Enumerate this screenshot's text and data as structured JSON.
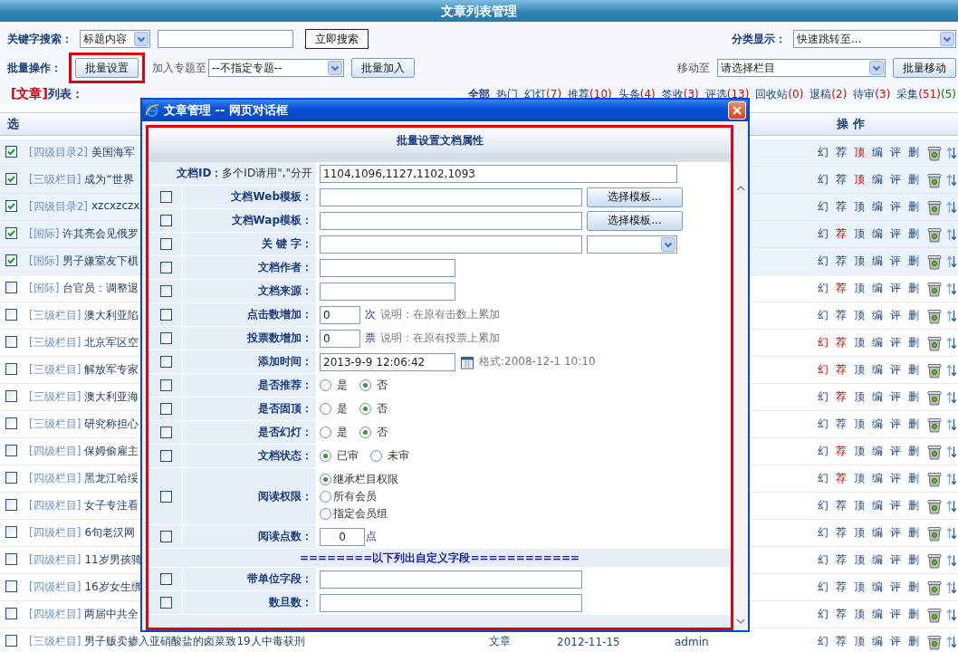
{
  "page_title": "文章列表管理",
  "search": {
    "label": "关键字搜索：",
    "scope": "标题内容",
    "button": "立即搜索"
  },
  "category": {
    "label": "分类显示：",
    "select": "快速跳转至..."
  },
  "batch": {
    "label": "批量操作：",
    "settings_button": "批量设置",
    "settings_highlighted": true,
    "topic_label": "加入专题至",
    "topic_select": "--不指定专题--",
    "add_button": "批量加入",
    "move_label": "移动至",
    "move_select": "请选择栏目",
    "move_button": "批量移动"
  },
  "list_heading": {
    "tag": "[文章]",
    "label": "列表："
  },
  "filters": [
    {
      "label": "全部",
      "selected": true
    },
    {
      "label": "热门",
      "selected": false
    },
    {
      "label": "幻灯",
      "selected": false,
      "counts": [
        {
          "text": "(7)",
          "color": "#cc0000"
        }
      ]
    },
    {
      "label": "推荐",
      "selected": false,
      "counts": [
        {
          "text": "(10)",
          "color": "#cc0000"
        }
      ]
    },
    {
      "label": "头条",
      "selected": false,
      "counts": [
        {
          "text": "(4)",
          "color": "#cc0000"
        }
      ]
    },
    {
      "label": "签收",
      "selected": false,
      "counts": [
        {
          "text": "(3)",
          "color": "#cc0000"
        }
      ]
    },
    {
      "label": "评选",
      "selected": false,
      "counts": [
        {
          "text": "(13)",
          "color": "#cc0000"
        }
      ]
    },
    {
      "label": "回收站",
      "selected": false,
      "counts": [
        {
          "text": "(0)",
          "color": "#cc0000"
        }
      ]
    },
    {
      "label": "退稿",
      "selected": false,
      "counts": [
        {
          "text": "(2)",
          "color": "#cc0000"
        }
      ]
    },
    {
      "label": "待审",
      "selected": false,
      "counts": [
        {
          "text": "(3)",
          "color": "#cc0000"
        }
      ]
    },
    {
      "label": "采集",
      "selected": false,
      "counts": [
        {
          "text": "(51)",
          "color": "#cc0000"
        },
        {
          "text": "(5)",
          "color": "#008000"
        }
      ]
    }
  ],
  "columns": {
    "select": "选",
    "actions": "操 作"
  },
  "rows": [
    {
      "checked": true,
      "category": "[四级目录2]",
      "title": "美国海军",
      "actions": [
        {
          "label": "幻",
          "on": false
        },
        {
          "label": "荐",
          "on": false
        },
        {
          "label": "顶",
          "on": true
        },
        {
          "label": "编",
          "on": false
        },
        {
          "label": "评",
          "on": false
        },
        {
          "label": "删",
          "on": false
        }
      ]
    },
    {
      "checked": true,
      "category": "[三级栏目]",
      "title": "成为“世界",
      "actions": [
        {
          "label": "幻",
          "on": false
        },
        {
          "label": "荐",
          "on": false
        },
        {
          "label": "顶",
          "on": true
        },
        {
          "label": "编",
          "on": false
        },
        {
          "label": "评",
          "on": false
        },
        {
          "label": "删",
          "on": false
        }
      ]
    },
    {
      "checked": true,
      "category": "[四级目录2]",
      "title": "xzcxzczx",
      "actions": [
        {
          "label": "幻",
          "on": false
        },
        {
          "label": "荐",
          "on": false
        },
        {
          "label": "顶",
          "on": false
        },
        {
          "label": "编",
          "on": false
        },
        {
          "label": "评",
          "on": false
        },
        {
          "label": "删",
          "on": false
        }
      ]
    },
    {
      "checked": true,
      "category": "[国际]",
      "title": "许其亮会见俄罗",
      "actions": [
        {
          "label": "幻",
          "on": false
        },
        {
          "label": "荐",
          "on": true
        },
        {
          "label": "顶",
          "on": false
        },
        {
          "label": "编",
          "on": false
        },
        {
          "label": "评",
          "on": false
        },
        {
          "label": "删",
          "on": false
        }
      ]
    },
    {
      "checked": true,
      "category": "[国际]",
      "title": "男子嫌室友下棋",
      "actions": [
        {
          "label": "幻",
          "on": false
        },
        {
          "label": "荐",
          "on": false
        },
        {
          "label": "顶",
          "on": false
        },
        {
          "label": "编",
          "on": false
        },
        {
          "label": "评",
          "on": false
        },
        {
          "label": "删",
          "on": false
        }
      ]
    },
    {
      "checked": false,
      "category": "[国际]",
      "title": "台官员：调整退",
      "actions": [
        {
          "label": "幻",
          "on": false
        },
        {
          "label": "荐",
          "on": true
        },
        {
          "label": "顶",
          "on": false
        },
        {
          "label": "编",
          "on": false
        },
        {
          "label": "评",
          "on": false
        },
        {
          "label": "删",
          "on": false
        }
      ]
    },
    {
      "checked": false,
      "category": "[三级栏目]",
      "title": "澳大利亚陷",
      "actions": [
        {
          "label": "幻",
          "on": false
        },
        {
          "label": "荐",
          "on": false
        },
        {
          "label": "顶",
          "on": false
        },
        {
          "label": "编",
          "on": false
        },
        {
          "label": "评",
          "on": false
        },
        {
          "label": "删",
          "on": false
        }
      ]
    },
    {
      "checked": false,
      "category": "[三级栏目]",
      "title": "北京军区空",
      "actions": [
        {
          "label": "幻",
          "on": true
        },
        {
          "label": "荐",
          "on": true
        },
        {
          "label": "顶",
          "on": false
        },
        {
          "label": "编",
          "on": false
        },
        {
          "label": "评",
          "on": false
        },
        {
          "label": "删",
          "on": false
        }
      ]
    },
    {
      "checked": false,
      "category": "[三级栏目]",
      "title": "解放军专家",
      "actions": [
        {
          "label": "幻",
          "on": true
        },
        {
          "label": "荐",
          "on": true
        },
        {
          "label": "顶",
          "on": false
        },
        {
          "label": "编",
          "on": false
        },
        {
          "label": "评",
          "on": false
        },
        {
          "label": "删",
          "on": false
        }
      ]
    },
    {
      "checked": false,
      "category": "[三级栏目]",
      "title": "澳大利亚海",
      "actions": [
        {
          "label": "幻",
          "on": false
        },
        {
          "label": "荐",
          "on": true
        },
        {
          "label": "顶",
          "on": false
        },
        {
          "label": "编",
          "on": false
        },
        {
          "label": "评",
          "on": false
        },
        {
          "label": "删",
          "on": false
        }
      ]
    },
    {
      "checked": false,
      "category": "[三级栏目]",
      "title": "研究称担心",
      "actions": [
        {
          "label": "幻",
          "on": false
        },
        {
          "label": "荐",
          "on": false
        },
        {
          "label": "顶",
          "on": false
        },
        {
          "label": "编",
          "on": false
        },
        {
          "label": "评",
          "on": false
        },
        {
          "label": "删",
          "on": false
        }
      ]
    },
    {
      "checked": false,
      "category": "[四级栏目]",
      "title": "保姆偷雇主",
      "actions": [
        {
          "label": "幻",
          "on": false
        },
        {
          "label": "荐",
          "on": true
        },
        {
          "label": "顶",
          "on": false
        },
        {
          "label": "编",
          "on": false
        },
        {
          "label": "评",
          "on": false
        },
        {
          "label": "删",
          "on": false
        }
      ]
    },
    {
      "checked": false,
      "category": "[四级栏目]",
      "title": "黑龙江哈绥",
      "actions": [
        {
          "label": "幻",
          "on": false
        },
        {
          "label": "荐",
          "on": true
        },
        {
          "label": "顶",
          "on": false
        },
        {
          "label": "编",
          "on": false
        },
        {
          "label": "评",
          "on": false
        },
        {
          "label": "删",
          "on": false
        }
      ]
    },
    {
      "checked": false,
      "category": "[四级栏目]",
      "title": "女子专注看",
      "actions": [
        {
          "label": "幻",
          "on": false
        },
        {
          "label": "荐",
          "on": false
        },
        {
          "label": "顶",
          "on": false
        },
        {
          "label": "编",
          "on": false
        },
        {
          "label": "评",
          "on": false
        },
        {
          "label": "删",
          "on": false
        }
      ]
    },
    {
      "checked": false,
      "category": "[四级栏目]",
      "title": "6旬老汉网",
      "actions": [
        {
          "label": "幻",
          "on": false
        },
        {
          "label": "荐",
          "on": false
        },
        {
          "label": "顶",
          "on": false
        },
        {
          "label": "编",
          "on": false
        },
        {
          "label": "评",
          "on": false
        },
        {
          "label": "删",
          "on": false
        }
      ]
    },
    {
      "checked": false,
      "category": "[四级栏目]",
      "title": "11岁男孩骑",
      "actions": [
        {
          "label": "幻",
          "on": false
        },
        {
          "label": "荐",
          "on": false
        },
        {
          "label": "顶",
          "on": false
        },
        {
          "label": "编",
          "on": false
        },
        {
          "label": "评",
          "on": false
        },
        {
          "label": "删",
          "on": false
        }
      ]
    },
    {
      "checked": false,
      "category": "[四级栏目]",
      "title": "16岁女生绑",
      "actions": [
        {
          "label": "幻",
          "on": false
        },
        {
          "label": "荐",
          "on": false
        },
        {
          "label": "顶",
          "on": false
        },
        {
          "label": "编",
          "on": false
        },
        {
          "label": "评",
          "on": false
        },
        {
          "label": "删",
          "on": false
        }
      ]
    },
    {
      "checked": false,
      "category": "[四级栏目]",
      "title": "两届中共全",
      "actions": [
        {
          "label": "幻",
          "on": false
        },
        {
          "label": "荐",
          "on": false
        },
        {
          "label": "顶",
          "on": false
        },
        {
          "label": "编",
          "on": false
        },
        {
          "label": "评",
          "on": false
        },
        {
          "label": "删",
          "on": false
        }
      ]
    },
    {
      "checked": false,
      "category": "[三级栏目]",
      "title": "男子贩卖掺入亚硝酸盐的卤菜致19人中毒获刑",
      "type": "文章",
      "date": "2012-11-15",
      "author": "admin",
      "actions": [
        {
          "label": "幻",
          "on": false
        },
        {
          "label": "荐",
          "on": false
        },
        {
          "label": "顶",
          "on": false
        },
        {
          "label": "编",
          "on": false
        },
        {
          "label": "评",
          "on": false
        },
        {
          "label": "删",
          "on": false
        }
      ]
    }
  ],
  "dialog": {
    "title": "文章管理 -- 网页对话框",
    "heading": "批量设置文档属性",
    "fields": [
      {
        "kind": "id",
        "label": "文档ID：",
        "hint": "多个ID请用\",\"分开",
        "value": "1104,1096,1127,1102,1093"
      },
      {
        "kind": "template",
        "checked": false,
        "label": "文档Web模板：",
        "button": "选择模板..."
      },
      {
        "kind": "template",
        "checked": false,
        "label": "文档Wap模板：",
        "button": "选择模板..."
      },
      {
        "kind": "keyword",
        "checked": false,
        "label": "关 键 字："
      },
      {
        "kind": "text",
        "checked": false,
        "label": "文档作者："
      },
      {
        "kind": "text",
        "checked": false,
        "label": "文档来源："
      },
      {
        "kind": "count",
        "checked": false,
        "label": "点击数增加：",
        "value": "0",
        "unit": "次",
        "note": "说明：在原有击数上累加"
      },
      {
        "kind": "count",
        "checked": false,
        "label": "投票数增加：",
        "value": "0",
        "unit": "票",
        "note": "说明：在原有投票上累加"
      },
      {
        "kind": "date",
        "checked": false,
        "label": "添加时间：",
        "value": "2013-9-9 12:06:42",
        "note": "格式:2008-12-1 10:10"
      },
      {
        "kind": "radio",
        "checked": false,
        "label": "是否推荐：",
        "options": [
          {
            "label": "是",
            "selected": false
          },
          {
            "label": "否",
            "selected": true
          }
        ]
      },
      {
        "kind": "radio",
        "checked": false,
        "label": "是否固顶：",
        "options": [
          {
            "label": "是",
            "selected": false
          },
          {
            "label": "否",
            "selected": true
          }
        ]
      },
      {
        "kind": "radio",
        "checked": false,
        "label": "是否幻灯：",
        "options": [
          {
            "label": "是",
            "selected": false
          },
          {
            "label": "否",
            "selected": true
          }
        ]
      },
      {
        "kind": "radio",
        "checked": false,
        "label": "文档状态：",
        "options": [
          {
            "label": "已审",
            "selected": true
          },
          {
            "label": "未审",
            "selected": false
          }
        ]
      },
      {
        "kind": "radio_stack",
        "checked": false,
        "label": "阅读权限：",
        "options": [
          {
            "label": "继承栏目权限",
            "selected": true
          },
          {
            "label": "所有会员",
            "selected": false
          },
          {
            "label": "指定会员组",
            "selected": false
          }
        ]
      },
      {
        "kind": "points",
        "checked": false,
        "label": "阅读点数：",
        "value": "0",
        "unit": "点"
      },
      {
        "kind": "divider",
        "text": "========以下列出自定义字段============"
      },
      {
        "kind": "wide",
        "checked": false,
        "label": "带单位字段："
      },
      {
        "kind": "wide",
        "checked": false,
        "label": "数旦数："
      }
    ]
  }
}
